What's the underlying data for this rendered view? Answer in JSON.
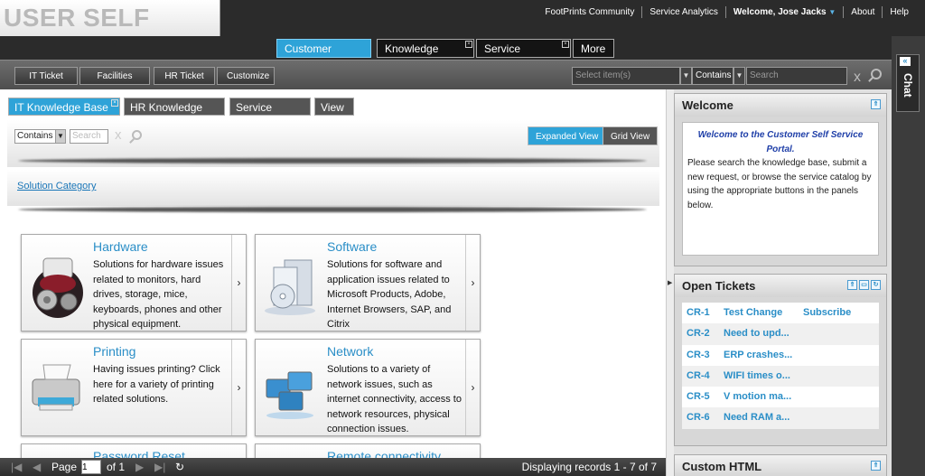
{
  "logo": {
    "text": "USER SELF SERVICE"
  },
  "toplinks": {
    "community": "FootPrints Community",
    "analytics": "Service Analytics",
    "welcome": "Welcome, Jose Jacks",
    "about": "About",
    "help": "Help"
  },
  "main_tabs": {
    "customer_console": "Customer Console",
    "knowledge_base": "Knowledge Base",
    "service_portfolio": "Service Portfolio",
    "more": "More"
  },
  "toolbar": {
    "it_ticket": "IT Ticket",
    "facilities_ticket": "Facilities Ticket",
    "hr_ticket": "HR Ticket",
    "customize": "Customize",
    "select_placeholder": "Select item(s)",
    "contains": "Contains",
    "search_placeholder": "Search"
  },
  "sub_tabs": {
    "it_kb": "IT Knowledge Base",
    "hr_kb": "HR Knowledge Base",
    "service_catalog": "Service Catalog",
    "view": "View"
  },
  "filter": {
    "contains": "Contains",
    "search_placeholder": "Search",
    "expanded_view": "Expanded View",
    "grid_view": "Grid View"
  },
  "solution_category": "Solution Category",
  "cards": [
    {
      "title": "Hardware",
      "desc": "Solutions for hardware issues related to monitors, hard drives, storage, mice, keyboards, phones and other physical equipment."
    },
    {
      "title": "Software",
      "desc": "Solutions for software and application issues related to Microsoft Products, Adobe, Internet Browsers, SAP, and Citrix"
    },
    {
      "title": "Printing",
      "desc": "Having issues printing? Click here for a variety of printing related solutions."
    },
    {
      "title": "Network",
      "desc": "Solutions to a variety of network issues, such as internet connectivity, access to network resources, physical connection issues."
    },
    {
      "title": "Password Reset",
      "desc": ""
    },
    {
      "title": "Remote connectivity",
      "desc": ""
    }
  ],
  "pager": {
    "page_label": "Page",
    "page_value": "1",
    "of_label": "of 1",
    "records": "Displaying records 1 - 7 of 7"
  },
  "welcome_panel": {
    "title": "Welcome",
    "heading": "Welcome to the Customer Self Service Portal.",
    "body": "Please search the knowledge base, submit a new request, or browse the service catalog by using the appropriate buttons in the panels below."
  },
  "tickets_panel": {
    "title": "Open Tickets",
    "rows": [
      {
        "id": "CR-1",
        "summary": "Test Change",
        "extra": "Subscribe"
      },
      {
        "id": "CR-2",
        "summary": "Need to upd...",
        "extra": ""
      },
      {
        "id": "CR-3",
        "summary": "ERP crashes...",
        "extra": ""
      },
      {
        "id": "CR-4",
        "summary": "WIFI times o...",
        "extra": ""
      },
      {
        "id": "CR-5",
        "summary": "V motion ma...",
        "extra": ""
      },
      {
        "id": "CR-6",
        "summary": "Need RAM a...",
        "extra": ""
      }
    ]
  },
  "custom_panel": {
    "title": "Custom HTML"
  },
  "chat": {
    "label": "Chat"
  }
}
